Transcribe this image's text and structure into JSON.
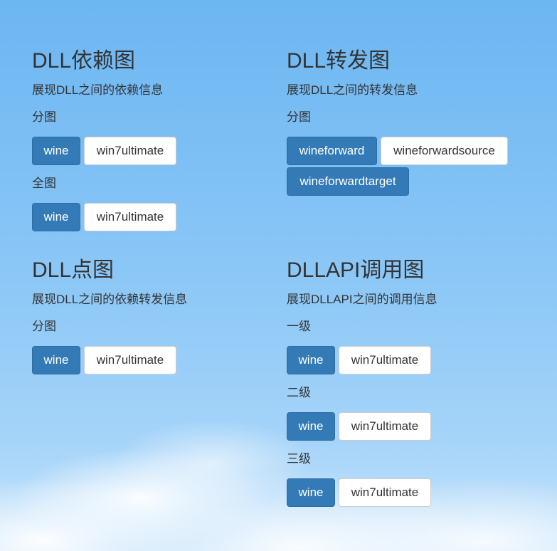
{
  "dep": {
    "title": "DLL依赖图",
    "desc": "展现DLL之间的依赖信息",
    "split_label": "分图",
    "split_buttons": [
      "wine",
      "win7ultimate"
    ],
    "full_label": "全图",
    "full_buttons": [
      "wine",
      "win7ultimate"
    ]
  },
  "fwd": {
    "title": "DLL转发图",
    "desc": "展现DLL之间的转发信息",
    "split_label": "分图",
    "buttons": [
      "wineforward",
      "wineforwardsource",
      "wineforwardtarget"
    ]
  },
  "dot": {
    "title": "DLL点图",
    "desc": "展现DLL之间的依赖转发信息",
    "split_label": "分图",
    "buttons": [
      "wine",
      "win7ultimate"
    ]
  },
  "api": {
    "title": "DLLAPI调用图",
    "desc": "展现DLLAPI之间的调用信息",
    "level1_label": "一级",
    "level1_buttons": [
      "wine",
      "win7ultimate"
    ],
    "level2_label": "二级",
    "level2_buttons": [
      "wine",
      "win7ultimate"
    ],
    "level3_label": "三级",
    "level3_buttons": [
      "wine",
      "win7ultimate"
    ]
  },
  "colors": {
    "primary_button": "#337ab7",
    "default_button": "#ffffff",
    "text": "#333333"
  }
}
